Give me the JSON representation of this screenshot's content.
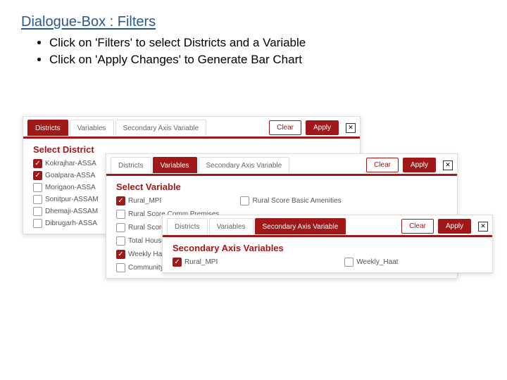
{
  "header": {
    "title": "Dialogue-Box : Filters",
    "bullet1": "Click on 'Filters' to select Districts and a Variable",
    "bullet2": "Click on 'Apply Changes' to Generate Bar Chart"
  },
  "common": {
    "tab_districts": "Districts",
    "tab_variables": "Variables",
    "tab_secondary": "Secondary Axis Variable",
    "clear": "Clear",
    "apply": "Apply",
    "close": "✕"
  },
  "d1": {
    "section": "Select District",
    "items": {
      "i0": "Kokrajhar-ASSA",
      "i1": "Goalpara-ASSA",
      "i2": "Morigaon-ASSA",
      "i3": "Sonitpur-ASSAM",
      "i4": "Dhemaji-ASSAM",
      "i5": "Dibrugarh-ASSA"
    }
  },
  "d2": {
    "section": "Select Variable",
    "items": {
      "i0": "Rural_MPI",
      "i1": "Rural Score Basic Amenities",
      "i2": "Rural Score Comm Premises",
      "i3": "Rural Score Media",
      "i4": "Total Households",
      "i5": "Weekly Haat",
      "i6": "Community Centre"
    }
  },
  "d3": {
    "section": "Secondary Axis Variables",
    "items": {
      "i0": "Rural_MPI",
      "i1": "Weekly_Haat"
    }
  }
}
